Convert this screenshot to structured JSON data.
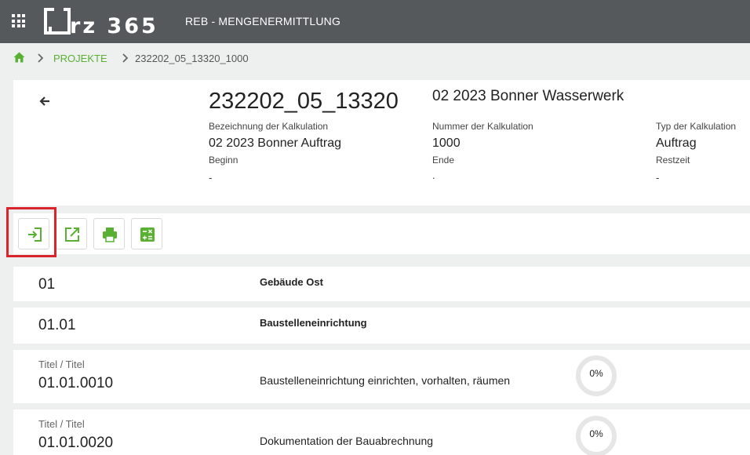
{
  "topbar": {
    "logo_text": "brz 365",
    "app_title": "REB - MENGENERMITTLUNG"
  },
  "breadcrumb": {
    "projects": "PROJEKTE",
    "current": "232202_05_13320_1000"
  },
  "header": {
    "project_number": "232202_05_13320",
    "project_name": "02 2023 Bonner Wasserwerk",
    "fields": {
      "bezeichnung_label": "Bezeichnung der Kalkulation",
      "bezeichnung_value": "02 2023 Bonner Auftrag",
      "nummer_label": "Nummer der Kalkulation",
      "nummer_value": "1000",
      "typ_label": "Typ der Kalkulation",
      "typ_value": "Auftrag",
      "beginn_label": "Beginn",
      "beginn_value": "-",
      "ende_label": "Ende",
      "ende_value": ".",
      "restzeit_label": "Restzeit",
      "restzeit_value": "-"
    }
  },
  "toolbar": {
    "icons": [
      "import-icon",
      "open-external-icon",
      "print-icon",
      "calculator-icon"
    ]
  },
  "rows": [
    {
      "number": "01",
      "title": "Gebäude Ost"
    },
    {
      "number": "01.01",
      "title": "Baustelleneinrichtung"
    },
    {
      "subtitle": "Titel / Titel",
      "number": "01.01.0010",
      "description": "Baustelleneinrichtung einrichten, vorhalten, räumen",
      "progress": "0%"
    },
    {
      "subtitle": "Titel / Titel",
      "number": "01.01.0020",
      "description": "Dokumentation der Bauabrechnung",
      "progress": "0%"
    }
  ],
  "colors": {
    "topbar": "#55595c",
    "accent_green": "#5ab031",
    "highlight_red": "#d9232d",
    "background": "#eef0f0"
  }
}
